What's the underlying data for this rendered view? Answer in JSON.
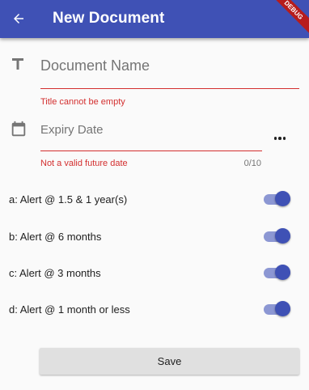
{
  "appbar": {
    "title": "New Document",
    "back_icon": "arrow-back-icon",
    "background": "#3f51b5",
    "debug_banner": "DEBUG"
  },
  "form": {
    "title_field": {
      "icon": "text-fields-icon",
      "placeholder": "Document Name",
      "error": "Title cannot be empty"
    },
    "expiry_field": {
      "icon": "calendar-icon",
      "placeholder": "Expiry Date",
      "error": "Not a valid future date",
      "counter": "0/10",
      "more_icon": "more-horiz-icon"
    },
    "error_color": "#d32f2f"
  },
  "alerts": [
    {
      "label": "a: Alert @ 1.5 & 1 year(s)",
      "on": true
    },
    {
      "label": "b: Alert @ 6 months",
      "on": true
    },
    {
      "label": "c: Alert @ 3 months",
      "on": true
    },
    {
      "label": "d: Alert @ 1 month or less",
      "on": true
    }
  ],
  "save_label": "Save"
}
